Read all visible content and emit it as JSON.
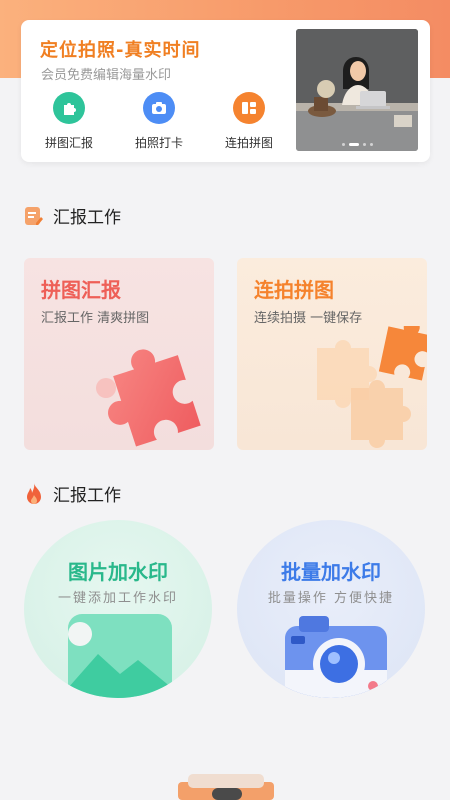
{
  "banner": {
    "title": "定位拍照-真实时间",
    "subtitle": "会员免费编辑海量水印",
    "actions": [
      {
        "label": "拼图汇报",
        "icon": "puzzle-icon",
        "color": "#2ec49a"
      },
      {
        "label": "拍照打卡",
        "icon": "camera-icon",
        "color": "#4d8df5"
      },
      {
        "label": "连拍拼图",
        "icon": "layout-grid-icon",
        "color": "#f5832f"
      }
    ]
  },
  "section1": {
    "title": "汇报工作",
    "icon": "report-doc-icon"
  },
  "cards": [
    {
      "title": "拼图汇报",
      "subtitle": "汇报工作 清爽拼图",
      "color": "#ee5f57",
      "bg": "#f7e3e2"
    },
    {
      "title": "连拍拼图",
      "subtitle": "连续拍摄 一键保存",
      "color": "#f5822c",
      "bg": "#fbecdd"
    }
  ],
  "section2": {
    "title": "汇报工作",
    "icon": "flame-icon"
  },
  "circles": [
    {
      "title": "图片加水印",
      "subtitle": "一键添加工作水印",
      "color": "#29b88b",
      "bg": "#dcf3ea"
    },
    {
      "title": "批量加水印",
      "subtitle": "批量操作 方便快捷",
      "color": "#3d7be8",
      "bg": "#e2e8f7"
    }
  ]
}
